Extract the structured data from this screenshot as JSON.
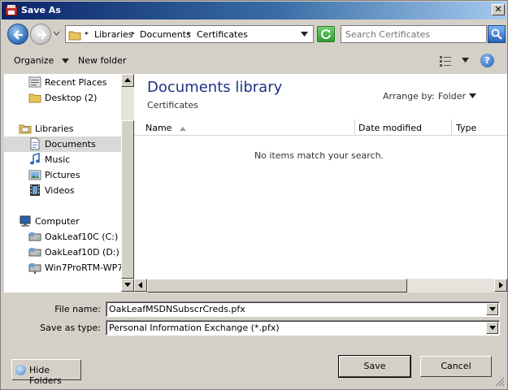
{
  "window": {
    "title": "Save As"
  },
  "address": {
    "crumbs": [
      "Libraries",
      "Documents",
      "Certificates"
    ]
  },
  "search": {
    "placeholder": "Search Certificates"
  },
  "toolbar": {
    "organize_label": "Organize",
    "new_folder_label": "New folder"
  },
  "nav": {
    "items": [
      {
        "label": "Recent Places",
        "icon": "recent-places-icon",
        "selected": false
      },
      {
        "label": "Desktop (2)",
        "icon": "desktop-folder-icon",
        "selected": false
      },
      {
        "label": "Libraries",
        "icon": "libraries-icon",
        "selected": false
      },
      {
        "label": "Documents",
        "icon": "documents-icon",
        "selected": true
      },
      {
        "label": "Music",
        "icon": "music-icon",
        "selected": false
      },
      {
        "label": "Pictures",
        "icon": "pictures-icon",
        "selected": false
      },
      {
        "label": "Videos",
        "icon": "videos-icon",
        "selected": false
      },
      {
        "label": "Computer",
        "icon": "computer-icon",
        "selected": false
      },
      {
        "label": "OakLeaf10C (C:)",
        "icon": "drive-icon",
        "selected": false
      },
      {
        "label": "OakLeaf10D (D:)",
        "icon": "drive-icon",
        "selected": false
      },
      {
        "label": "Win7ProRTM-WP7",
        "icon": "network-drive-icon",
        "selected": false
      }
    ]
  },
  "content": {
    "library_title": "Documents library",
    "library_subtitle": "Certificates",
    "arrange_label": "Arrange by:",
    "arrange_value": "Folder",
    "columns": [
      "Name",
      "Date modified",
      "Type"
    ],
    "empty_message": "No items match your search."
  },
  "form": {
    "file_name_label": "File name:",
    "file_name_value": "OakLeafMSDNSubscrCreds.pfx",
    "save_type_label": "Save as type:",
    "save_type_value": "Personal Information Exchange (*.pfx)"
  },
  "buttons": {
    "hide_folders": "Hide Folders",
    "save": "Save",
    "cancel": "Cancel"
  },
  "colors": {
    "title_bar": "#0a246a",
    "library_title": "#1e3287",
    "selection": "#d9d9d9"
  }
}
